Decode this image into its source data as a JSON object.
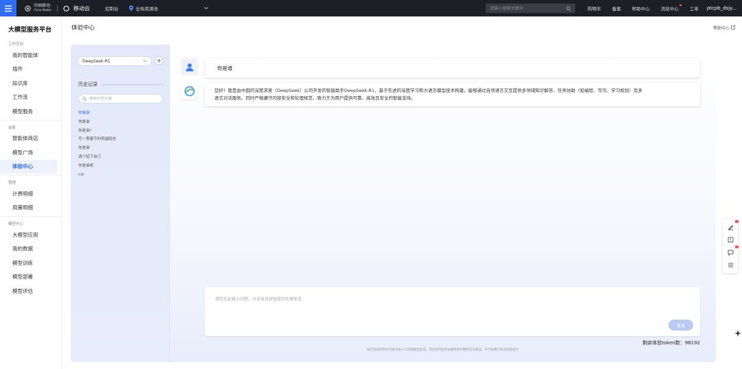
{
  "topbar": {
    "brand_cn": "中国移动",
    "brand_en": "China Mobile",
    "cloud_name": "移动云",
    "console": "控制台",
    "region": "全局资源池",
    "search_placeholder": "请输入搜索关键词",
    "cart": "购物车",
    "filing": "备案",
    "help_center": "帮助中心",
    "message_center": "消息中心",
    "ticket": "工单",
    "user": "ptcpb_dsjy..."
  },
  "sidebar": {
    "title": "大模型服务平台",
    "sections": [
      {
        "label": "工作空间",
        "items": [
          "我的智能体",
          "插件",
          "知识库",
          "工作流",
          "模型服务"
        ]
      },
      {
        "label": "探索",
        "items": [
          "智能体商店",
          "模型广场",
          "体验中心"
        ]
      },
      {
        "label": "管理",
        "items": [
          "计费明细",
          "用量明细"
        ]
      },
      {
        "label": "模型中心",
        "items": [
          "大模型应用",
          "我的数据",
          "模型训练",
          "模型部署",
          "模型评估"
        ]
      }
    ],
    "active": "体验中心"
  },
  "header": {
    "title": "体验中心",
    "help": "帮助中心"
  },
  "history": {
    "model": "DeepSeek-R1",
    "title": "历史记录",
    "search_placeholder": "搜索历史记录",
    "items": [
      "你是谁",
      "你是谁",
      "你是谁?",
      "写一首春节的祝福短信",
      "你是谁",
      "请介绍下自己",
      "你是谁呢",
      "nih"
    ]
  },
  "chat": {
    "user_message": "你是谁",
    "bot_line1": "您好！我是由中国的深度求索（DeepSeek）公司开发的智能助手DeepSeek-R1，基于先进的深度学习和大语言模型技术构建，能够通过自然语言交互提供多领域知识解答、任务协助（如编程、写作、学习规划）及多",
    "bot_line2": "语言对话服务。同时严格遵守内容安全和伦理规范，致力于为用户提供可靠、高效且安全的智能支持。",
    "input_placeholder": "请您在此输入问题，点击发送按钮或回车键发送",
    "send": "发送",
    "token_label": "剩余体验token数：",
    "token_value": "98192",
    "disclaimer": "服务生成的所有内容均由人工智能模型生成，其生成内容的准确性和完整性无法保证，不代表我们的态度或观点"
  },
  "colors": {
    "accent": "#2f6df6",
    "topbar_bg": "#1c1f26",
    "panel_bg": "#e3e9f9",
    "send_disabled": "#b8c9f2"
  }
}
